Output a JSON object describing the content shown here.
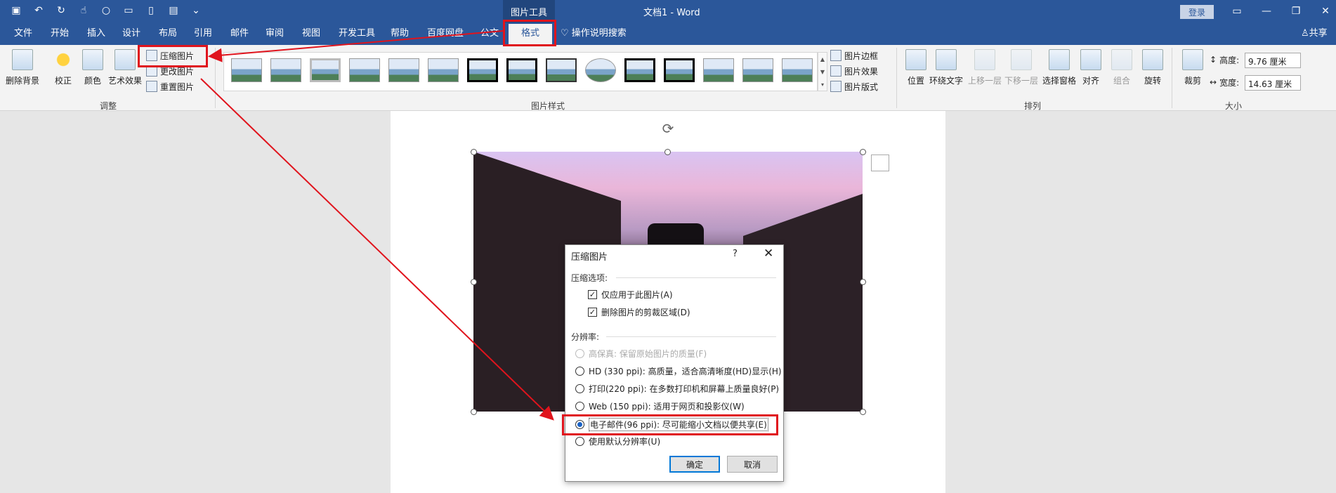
{
  "titlebar": {
    "qat_icons": [
      "save-icon",
      "undo-icon",
      "redo-icon",
      "touch-mode-icon",
      "circle-icon",
      "open-folder-icon",
      "new-doc-icon",
      "save-as-icon",
      "customize-icon"
    ],
    "tool_context": "图片工具",
    "doc_title": "文档1  -  Word",
    "login": "登录",
    "window_controls": [
      "ribbon-display-icon",
      "minimize-icon",
      "restore-icon",
      "close-icon"
    ]
  },
  "tabs": {
    "items": [
      "文件",
      "开始",
      "插入",
      "设计",
      "布局",
      "引用",
      "邮件",
      "审阅",
      "视图",
      "开发工具",
      "帮助",
      "百度网盘",
      "公文",
      "格式"
    ],
    "active": "格式",
    "tell_me": "操作说明搜索",
    "share": "共享"
  },
  "ribbon": {
    "adjust": {
      "remove_bg": "删除背景",
      "correct": "校正",
      "color": "颜色",
      "art_effect": "艺术效果",
      "compress": "压缩图片",
      "change": "更改图片",
      "reset": "重置图片",
      "label": "调整"
    },
    "styles": {
      "label": "图片样式",
      "border": "图片边框",
      "effect": "图片效果",
      "layout": "图片版式"
    },
    "arrange": {
      "label": "排列",
      "position": "位置",
      "wrap": "环绕文字",
      "forward": "上移一层",
      "backward": "下移一层",
      "selection_pane": "选择窗格",
      "align": "对齐",
      "group": "组合",
      "rotate": "旋转"
    },
    "size": {
      "label": "大小",
      "crop": "裁剪",
      "height_label": "高度:",
      "height_value": "9.76 厘米",
      "width_label": "宽度:",
      "width_value": "14.63 厘米"
    }
  },
  "dialog": {
    "title": "压缩图片",
    "help": "?",
    "close": "✕",
    "compress_section": "压缩选项:",
    "opt_apply_only": "仅应用于此图片(A)",
    "opt_delete_crop": "删除图片的剪裁区域(D)",
    "resolution_section": "分辨率:",
    "res_hifi": "高保真: 保留原始图片的质量(F)",
    "res_hd": "HD (330 ppi): 高质量，适合高清晰度(HD)显示(H)",
    "res_print": "打印(220 ppi): 在多数打印机和屏幕上质量良好(P)",
    "res_web": "Web (150 ppi): 适用于网页和投影仪(W)",
    "res_email": "电子邮件(96 ppi): 尽可能缩小文档以便共享(E)",
    "res_default": "使用默认分辨率(U)",
    "ok": "确定",
    "cancel": "取消",
    "selected_resolution": "电子邮件(96 ppi): 尽可能缩小文档以便共享(E)"
  },
  "colors": {
    "ribbon_blue": "#2b579a",
    "annotation_red": "#e0141d",
    "radio_selected": "#1a62c5"
  }
}
